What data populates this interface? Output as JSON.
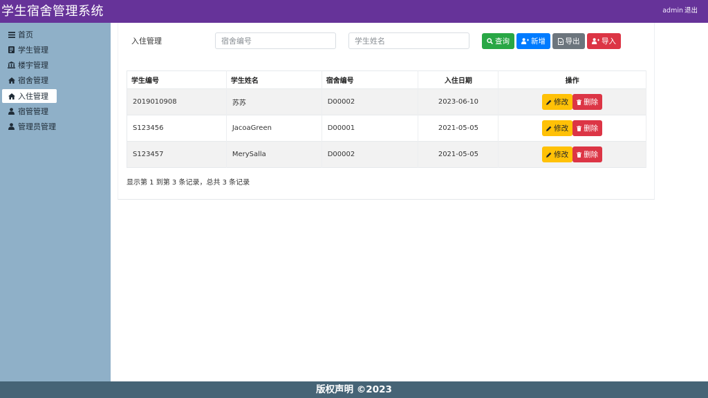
{
  "header": {
    "title": "学生宿舍管理系统",
    "user": "admin",
    "logout_label": "退出"
  },
  "sidebar": {
    "items": [
      {
        "label": "首页",
        "icon": "bars-icon"
      },
      {
        "label": "学生管理",
        "icon": "id-card-icon"
      },
      {
        "label": "楼宇管理",
        "icon": "building-icon"
      },
      {
        "label": "宿舍管理",
        "icon": "home-icon"
      },
      {
        "label": "入住管理",
        "icon": "home-icon",
        "active": true
      },
      {
        "label": "宿管管理",
        "icon": "user-icon"
      },
      {
        "label": "管理员管理",
        "icon": "user-icon"
      }
    ]
  },
  "search": {
    "label": "入住管理",
    "dorm_placeholder": "宿舍编号",
    "name_placeholder": "学生姓名"
  },
  "toolbar": {
    "query_label": "查询",
    "add_label": "新增",
    "export_label": "导出",
    "import_label": "导入"
  },
  "table": {
    "headers": [
      "学生编号",
      "学生姓名",
      "宿舍编号",
      "入住日期",
      "操作"
    ],
    "rows": [
      {
        "student_id": "2019010908",
        "name": "苏苏",
        "dorm_id": "D00002",
        "date": "2023-06-10"
      },
      {
        "student_id": "S123456",
        "name": "JacoaGreen",
        "dorm_id": "D00001",
        "date": "2021-05-05"
      },
      {
        "student_id": "S123457",
        "name": "MerySalla",
        "dorm_id": "D00002",
        "date": "2021-05-05"
      }
    ],
    "edit_label": "修改",
    "delete_label": "删除"
  },
  "summary": "显示第 1 到第 3 条记录，总共 3 条记录",
  "footer": {
    "text": "版权声明 ©2023"
  },
  "colors": {
    "header_bg": "#663399",
    "sidebar_bg": "#8fb0c8",
    "footer_bg": "#466476",
    "green": "#28a745",
    "blue": "#007bff",
    "gray": "#6c757d",
    "red": "#dc3545",
    "yellow": "#ffc107"
  }
}
